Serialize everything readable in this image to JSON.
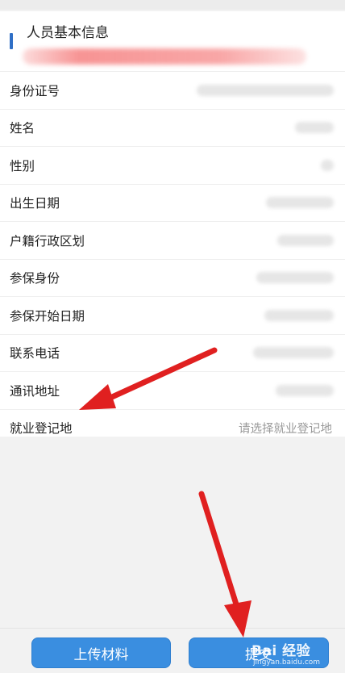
{
  "section": {
    "title": "人员基本信息"
  },
  "fields": [
    {
      "label": "身份证号"
    },
    {
      "label": "姓名"
    },
    {
      "label": "性别"
    },
    {
      "label": "出生日期"
    },
    {
      "label": "户籍行政区划"
    },
    {
      "label": "参保身份"
    },
    {
      "label": "参保开始日期"
    },
    {
      "label": "联系电话"
    },
    {
      "label": "通讯地址"
    },
    {
      "label": "就业登记地",
      "placeholder": "请选择就业登记地"
    }
  ],
  "buttons": {
    "upload": "上传材料",
    "submit": "提交"
  },
  "watermark": {
    "main": "Bai  经验",
    "sub": "jingyan.baidu.com"
  },
  "colors": {
    "accent": "#2f6fc6",
    "button": "#3a8ee0",
    "arrow": "#e02020"
  },
  "icons": {
    "annotation": "red-arrow-icon",
    "watermark": "baidu-paw-icon"
  }
}
